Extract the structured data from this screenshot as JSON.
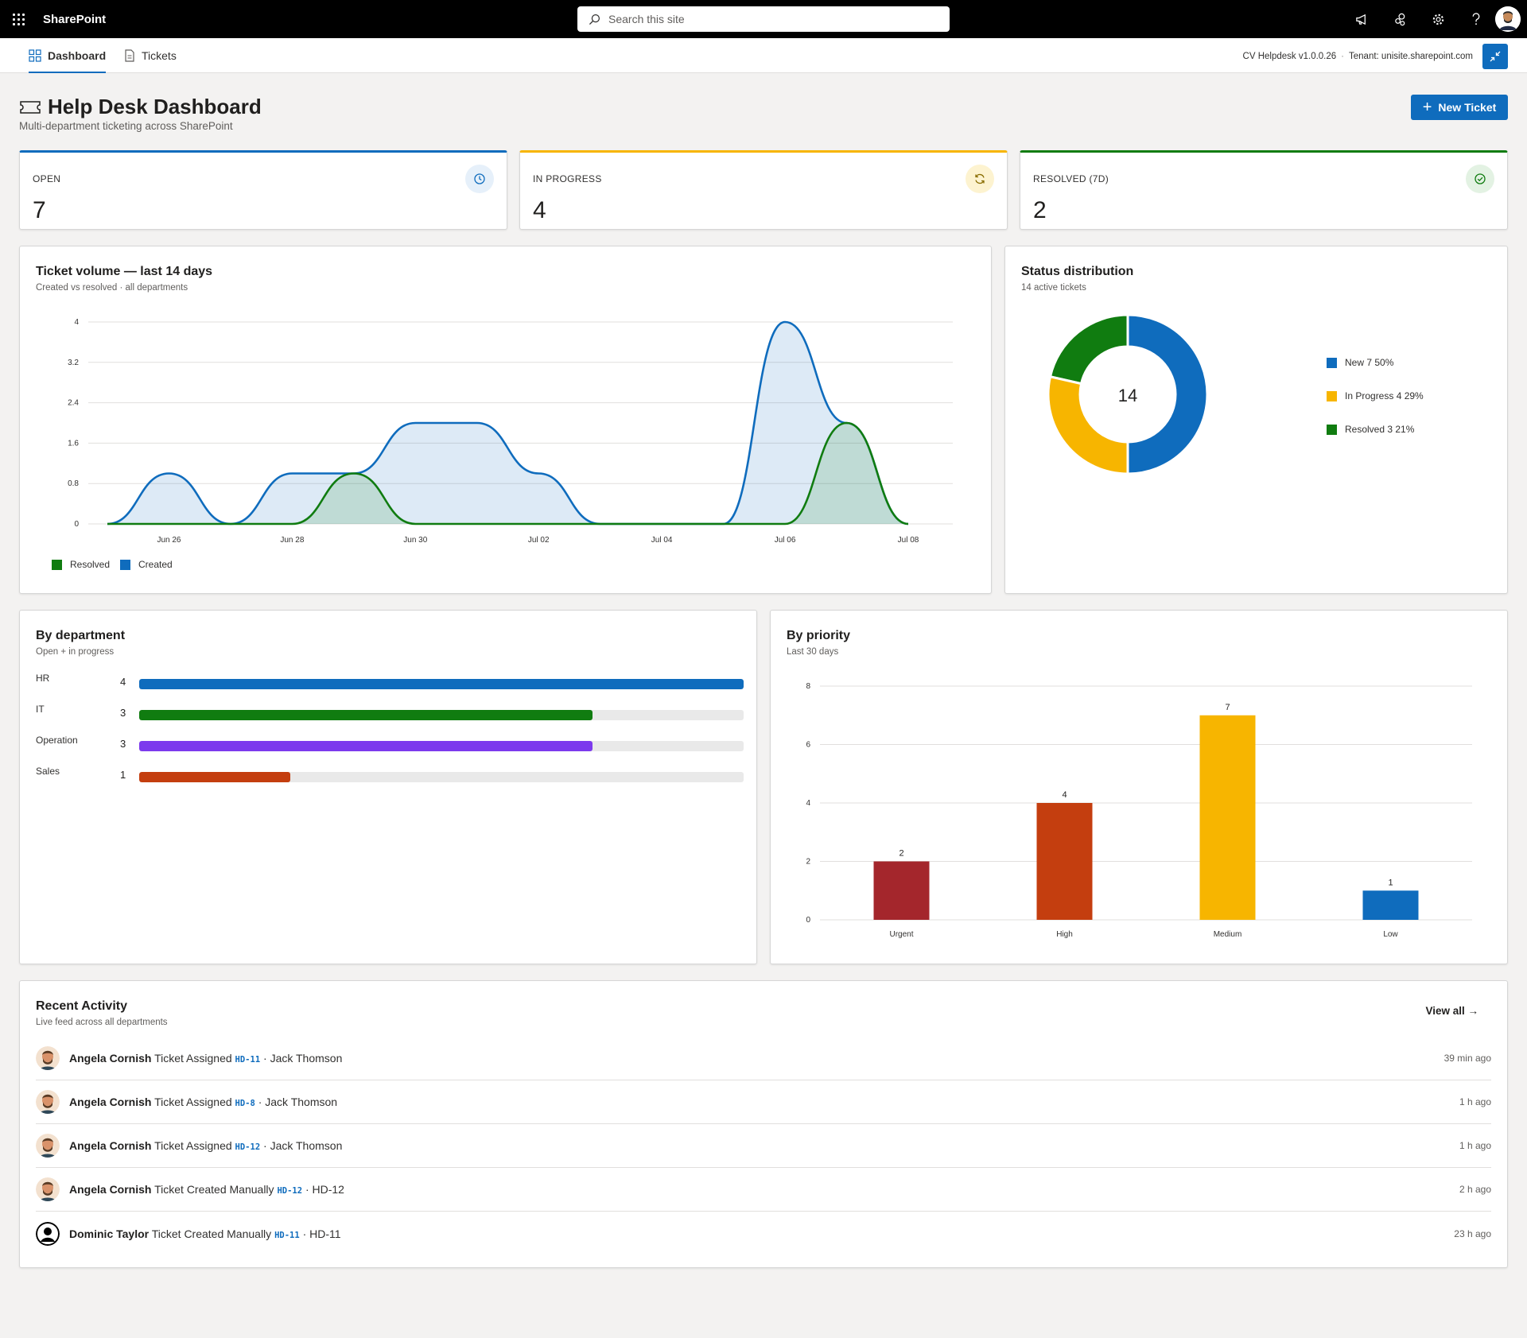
{
  "suite_bar": {
    "brand": "SharePoint",
    "search_placeholder": "Search this site"
  },
  "nav": {
    "tabs": [
      {
        "label": "Dashboard",
        "active": true
      },
      {
        "label": "Tickets",
        "active": false
      }
    ],
    "version": "CV Helpdesk v1.0.0.26",
    "tenant": "Tenant: unisite.sharepoint.com"
  },
  "header": {
    "title": "Help Desk Dashboard",
    "subtitle": "Multi-department ticketing across SharePoint",
    "new_ticket_label": "New Ticket"
  },
  "kpis": [
    {
      "label": "OPEN",
      "value": "7",
      "color": "#0f6cbd",
      "icon": "clock-icon"
    },
    {
      "label": "IN PROGRESS",
      "value": "4",
      "color": "#f7b500",
      "icon": "refresh-icon"
    },
    {
      "label": "RESOLVED (7D)",
      "value": "2",
      "color": "#107c10",
      "icon": "check-circle-icon"
    }
  ],
  "volume": {
    "title": "Ticket volume — last 14 days",
    "subtitle": "Created vs resolved · all departments"
  },
  "status": {
    "title": "Status distribution",
    "subtitle": "14 active tickets",
    "center": "14"
  },
  "department": {
    "title": "By department",
    "subtitle": "Open + in progress",
    "max": 4,
    "rows": [
      {
        "name": "HR",
        "value": 4,
        "color": "#0f6cbd"
      },
      {
        "name": "IT",
        "value": 3,
        "color": "#107c10"
      },
      {
        "name": "Operation",
        "value": 3,
        "color": "#7c3aed"
      },
      {
        "name": "Sales",
        "value": 1,
        "color": "#c43e0f"
      }
    ]
  },
  "priority": {
    "title": "By priority",
    "subtitle": "Last 30 days"
  },
  "chart_data": [
    {
      "type": "area",
      "x": [
        "Jun 25",
        "Jun 26",
        "Jun 27",
        "Jun 28",
        "Jun 29",
        "Jun 30",
        "Jul 01",
        "Jul 02",
        "Jul 03",
        "Jul 04",
        "Jul 05",
        "Jul 06",
        "Jul 07",
        "Jul 08"
      ],
      "x_tick_labels": [
        "Jun 26",
        "Jun 28",
        "Jun 30",
        "Jul 02",
        "Jul 04",
        "Jul 06",
        "Jul 08"
      ],
      "y_ticks": [
        "0",
        "0.8",
        "1.6",
        "2.4",
        "3.2",
        "4"
      ],
      "ylim": [
        0,
        4
      ],
      "grid": true,
      "legend_position": "bottom-left",
      "series": [
        {
          "name": "Resolved",
          "color": "#107c10",
          "values": [
            0,
            0,
            0,
            0,
            1,
            0,
            0,
            0,
            0,
            0,
            0,
            0,
            2,
            0
          ]
        },
        {
          "name": "Created",
          "color": "#0f6cbd",
          "values": [
            0,
            1,
            0,
            1,
            1,
            2,
            2,
            1,
            0,
            0,
            0,
            4,
            2,
            0
          ]
        }
      ]
    },
    {
      "type": "pie",
      "donut": true,
      "legend_position": "right",
      "slices": [
        {
          "label": "New 7 50%",
          "value": 7,
          "color": "#0f6cbd"
        },
        {
          "label": "In Progress 4 29%",
          "value": 4,
          "color": "#f7b500"
        },
        {
          "label": "Resolved 3 21%",
          "value": 3,
          "color": "#107c10"
        }
      ]
    },
    {
      "type": "bar",
      "categories": [
        "Urgent",
        "High",
        "Medium",
        "Low"
      ],
      "values": [
        2,
        4,
        7,
        1
      ],
      "colors": [
        "#a4262c",
        "#c43e0f",
        "#f7b500",
        "#0f6cbd"
      ],
      "y_ticks": [
        "0",
        "2",
        "4",
        "6",
        "8"
      ],
      "ylim": [
        0,
        8
      ],
      "grid": true
    }
  ],
  "activity": {
    "title": "Recent Activity",
    "subtitle": "Live feed across all departments",
    "view_all": "View all →",
    "items": [
      {
        "user": "Angela Cornish",
        "action": "Ticket Assigned",
        "ticket": "HD-11",
        "detail": "· Jack Thomson",
        "time": "39 min ago",
        "avatar": "angela"
      },
      {
        "user": "Angela Cornish",
        "action": "Ticket Assigned",
        "ticket": "HD-8",
        "detail": "· Jack Thomson",
        "time": "1 h ago",
        "avatar": "angela"
      },
      {
        "user": "Angela Cornish",
        "action": "Ticket Assigned",
        "ticket": "HD-12",
        "detail": "· Jack Thomson",
        "time": "1 h ago",
        "avatar": "angela"
      },
      {
        "user": "Angela Cornish",
        "action": "Ticket Created Manually",
        "ticket": "HD-12",
        "detail": "· HD-12",
        "time": "2 h ago",
        "avatar": "angela"
      },
      {
        "user": "Dominic Taylor",
        "action": "Ticket Created Manually",
        "ticket": "HD-11",
        "detail": "· HD-11",
        "time": "23 h ago",
        "avatar": "dominic"
      }
    ]
  }
}
